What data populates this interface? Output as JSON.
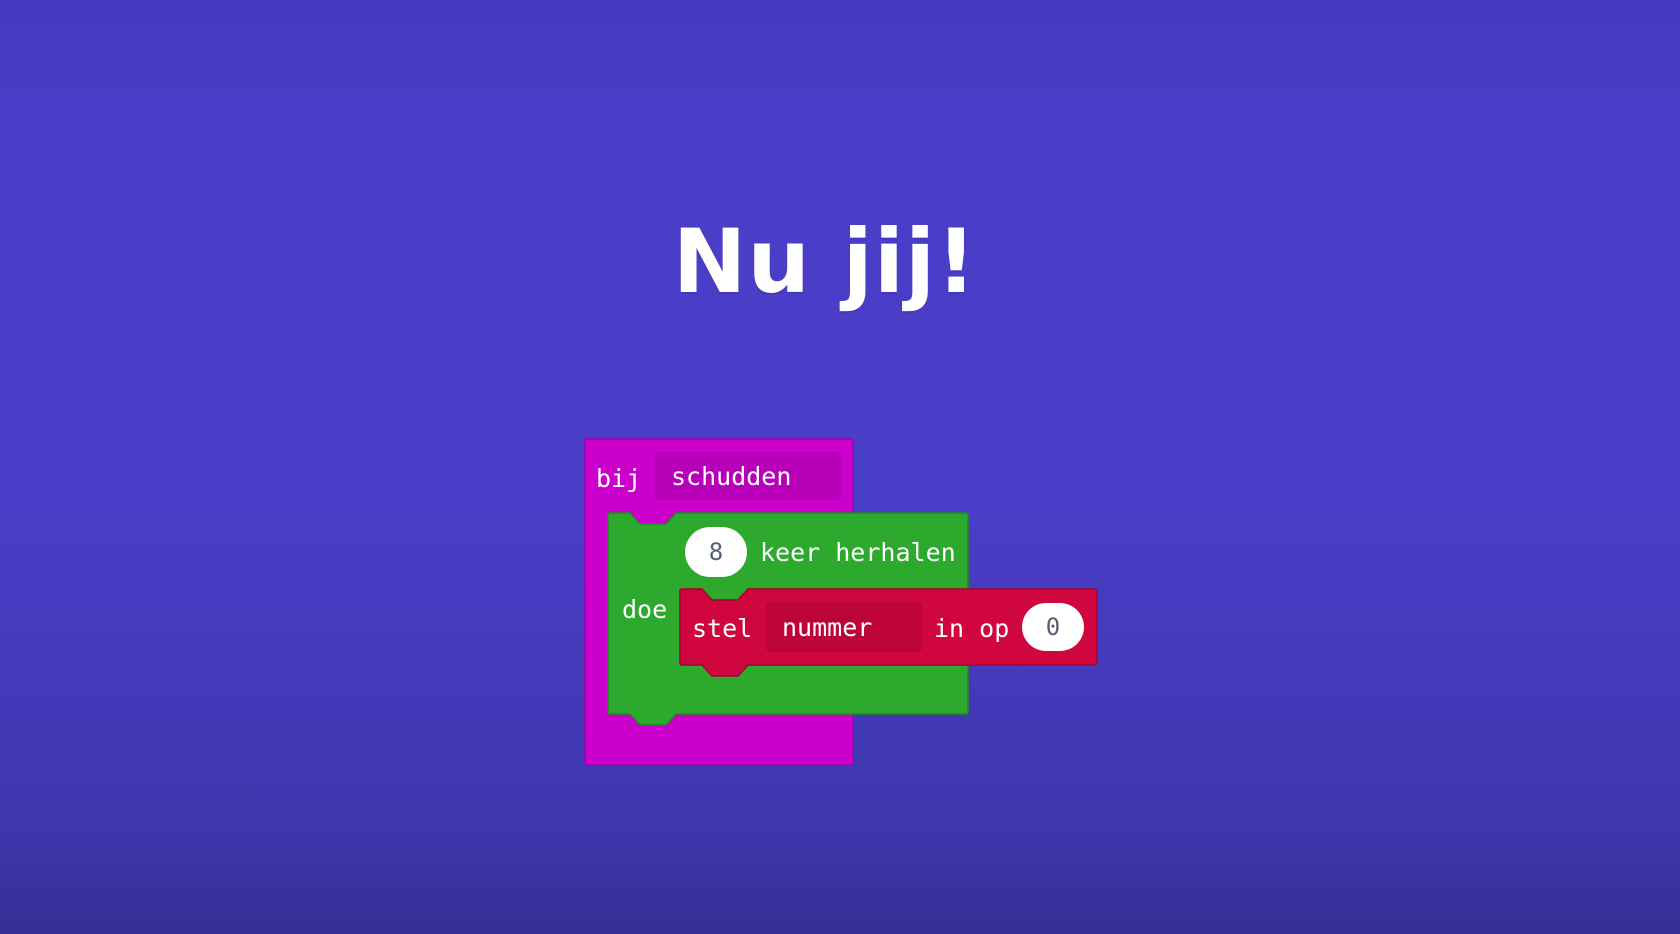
{
  "title": "Nu jij!",
  "blocks": {
    "event": {
      "label": "bij",
      "dropdown": "schudden",
      "do_label": "doe",
      "color": "#CC00CC",
      "field_color": "#B800B8"
    },
    "repeat": {
      "count": "8",
      "label": "keer herhalen",
      "color": "#2DAA2D"
    },
    "set": {
      "label": "stel",
      "variable": "nummer",
      "suffix": "in op",
      "value": "0",
      "color": "#D0063E",
      "field_color": "#BC0438"
    }
  },
  "colors": {
    "background": "#4A3DC7",
    "text": "#FFFFFF"
  }
}
